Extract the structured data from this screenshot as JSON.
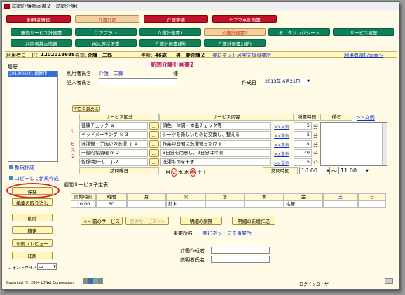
{
  "window": {
    "title": "訪問介護計画書２（訪問介護）"
  },
  "tabs1": [
    "利用者情報",
    "介護計画",
    "介護実績",
    "ケアマネ計画書"
  ],
  "tabs2": [
    "週間サービス計画書",
    "ケアプラン",
    "介護計画書1",
    "介護計画書2",
    "モニタリングシート",
    "サービス履歴"
  ],
  "tabs3": [
    "利用者基本情報",
    "ADL等状況書",
    "介護計画書(新)",
    "介護計画書2(新)"
  ],
  "patient": {
    "code_label": "利用者コード：",
    "code": "1202018688",
    "name_label": "名前:",
    "name": "介護　二郎",
    "age_label": "年齢:",
    "age": "46歳",
    "sex": "男",
    "care_level": "要介護２",
    "office": "楽にネット居宅支援事業所",
    "select_link": "利用者選択画面へ"
  },
  "history": {
    "label": "履歴",
    "item": "2013/06/21 編集中"
  },
  "new_link": "新規作成",
  "copy_link": "コピーして新規作成",
  "side_buttons": [
    "保存",
    "編集の取り消し",
    "削除",
    "確定",
    "印刷プレビュー",
    "印刷"
  ],
  "font_size": {
    "label": "フォントサイズ",
    "value": "中"
  },
  "copyright": "Copyright (C) 2004 LONet Corporation",
  "login": "ログインユーザー：",
  "form": {
    "title": "訪問介護計画書2",
    "user_label": "利用者氏名",
    "user_name": "介護　二郎",
    "sama": "様",
    "writer_label": "記入者氏名",
    "date_label": "作成日",
    "date_value": "2013年 6月21日"
  },
  "load_blank": "空白を読める",
  "svc_header": {
    "kubun": "サービス区分",
    "naiyou": "サービス内容",
    "time": "所要時間",
    "note": "備考",
    "note_link": ">>文例"
  },
  "svc_side": "サービス２",
  "rows": [
    {
      "kubun": "健康チェック ａ",
      "naiyou": "顔色・体調・体温チェック等",
      "link": ">>文例",
      "time": "5",
      "unit": "分"
    },
    {
      "kubun": "ベッドメーキング ｋ-3",
      "naiyou": "シーツを新しいものに交換し、整える",
      "link": ">>文例",
      "time": "5",
      "unit": "分"
    },
    {
      "kubun": "洗濯機・手洗いの洗濯 ｊ-1",
      "naiyou": "作業の合間に洗濯機をかける",
      "link": ">>文例",
      "time": "5",
      "unit": "分"
    },
    {
      "kubun": "一般的な調理 ｍ-2",
      "naiyou": "3日分を用意し、2日分は冷凍",
      "link": ">>文例",
      "time": "40",
      "unit": "分"
    },
    {
      "kubun": "乾燥(物干し) ｊ-2",
      "naiyou": "洗濯ものを干す",
      "link": ">>文例",
      "time": "5",
      "unit": "分"
    }
  ],
  "dots": "…",
  "visit": {
    "day_label": "訪問曜日",
    "days": [
      "月",
      "火",
      "水",
      "木",
      "金",
      "土",
      "日"
    ],
    "time_label": "訪問時間",
    "from": "10:00",
    "tilde": "～",
    "to": "11:00"
  },
  "schedule": {
    "title": "週間サービス予定表",
    "cols": [
      "開始時刻",
      "時間",
      "月",
      "火",
      "水",
      "木",
      "金",
      "土",
      "日"
    ],
    "row": [
      "10:00",
      "60",
      "",
      "鈴木",
      "",
      "",
      "佐藤",
      "",
      ""
    ]
  },
  "nav": {
    "prev": "<< 前のサービス",
    "next": "次のサービス>>",
    "del": "明細の削除",
    "add": "明細の新規作成"
  },
  "office": {
    "label": "事業所名",
    "value": "楽にネットデモ事業所"
  },
  "planner_label": "計画作成者",
  "explainer_label": "説明者氏名"
}
